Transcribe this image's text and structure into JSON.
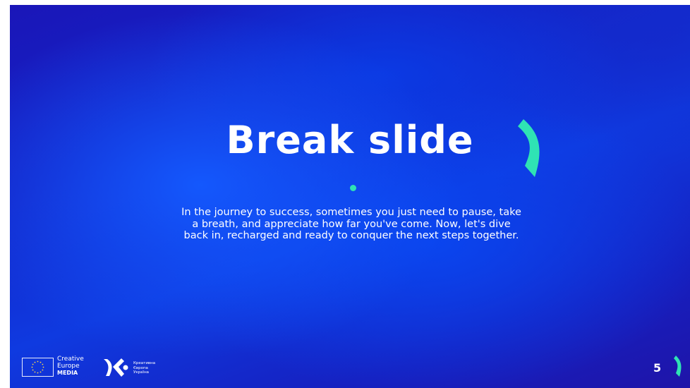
{
  "slide": {
    "title": "Break slide",
    "body": "In the journey to success, sometimes you just need to pause, take a breath, and appreciate how far you've come. Now, let's dive back in, recharged and ready to conquer the next steps together.",
    "page_number": "5"
  },
  "footer": {
    "eu_logo_lines": [
      "Creative",
      "Europe",
      "MEDIA"
    ],
    "ce_logo_lines": [
      "Креативна",
      "Європа",
      "Україна"
    ]
  },
  "colors": {
    "background": "#1430d8",
    "accent": "#2fe3b4",
    "text": "#ffffff"
  },
  "icons": {
    "title_mark": "bracket-arc-icon",
    "page_mark": "bracket-arc-icon",
    "eu_flag": "eu-flag-icon",
    "ce_mark": "creative-europe-ukraine-logo"
  }
}
